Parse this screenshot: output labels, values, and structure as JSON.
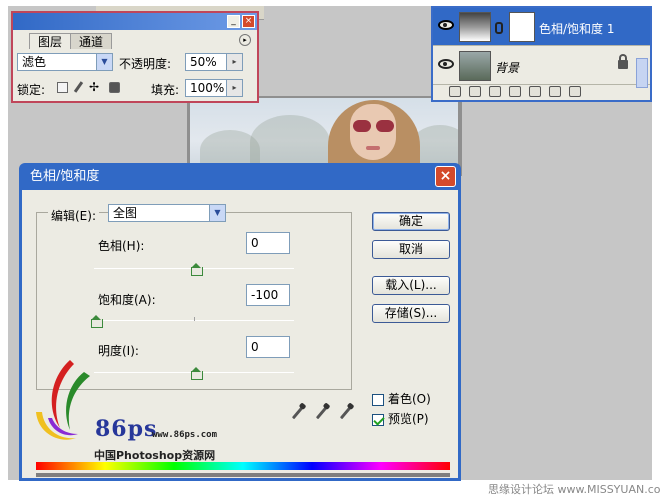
{
  "palette": {
    "tabs": [
      {
        "label": "图层"
      },
      {
        "label": "通道"
      }
    ],
    "blend_mode": "滤色",
    "opacity_label": "不透明度:",
    "opacity_value": "50%",
    "lock_label": "锁定:",
    "fill_label": "填充:",
    "fill_value": "100%",
    "minimize_glyph": "_",
    "close_glyph": "×",
    "menu_glyph": "▸"
  },
  "layers": {
    "items": [
      {
        "name": "色相/饱和度 1",
        "selected": true
      },
      {
        "name": "背景",
        "locked": true
      }
    ]
  },
  "dialog": {
    "title": "色相/饱和度",
    "close_glyph": "×",
    "edit_label": "编辑(E):",
    "edit_value": "全图",
    "dropdown_glyph": "▼",
    "sliders": [
      {
        "label": "色相(H):",
        "value": "0",
        "position": 0.5
      },
      {
        "label": "饱和度(A):",
        "value": "-100",
        "position": 0.0
      },
      {
        "label": "明度(I):",
        "value": "0",
        "position": 0.5
      }
    ],
    "buttons": {
      "ok": "确定",
      "cancel": "取消",
      "load": "载入(L)...",
      "save": "存储(S)..."
    },
    "colorize_label": "着色(O)",
    "colorize_checked": false,
    "preview_label": "预览(P)",
    "preview_checked": true
  },
  "logo": {
    "brand": "86ps",
    "url": "www.86ps.com",
    "name": "中国Photoshop资源网"
  },
  "watermark": "思缘设计论坛 www.MISSYUAN.com",
  "icons": [
    "eye-icon",
    "chain-link-icon",
    "lock-icon",
    "brush-icon",
    "move-icon",
    "eyedropper-icon",
    "eyedropper-plus-icon",
    "eyedropper-minus-icon",
    "close-icon",
    "minimize-icon"
  ]
}
